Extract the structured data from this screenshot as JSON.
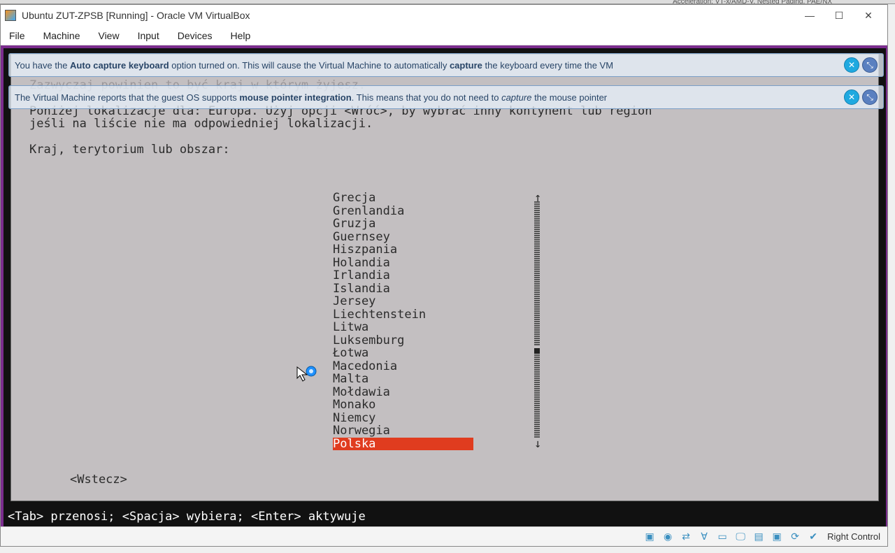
{
  "partial_top": "Acceleration:      VT-x/AMD-V, Nested Paging, PAE/NX",
  "titlebar": {
    "title": "Ubuntu ZUT-ZPSB [Running] - Oracle VM VirtualBox"
  },
  "menubar": [
    "File",
    "Machine",
    "View",
    "Input",
    "Devices",
    "Help"
  ],
  "notif1": {
    "pre": "You have the ",
    "bold": "Auto capture keyboard",
    "mid": " option turned on. This will cause the Virtual Machine to automatically ",
    "bold2": "capture",
    "post": " the keyboard every time the VM"
  },
  "notif2": {
    "pre": "The Virtual Machine reports that the guest OS supports ",
    "bold": "mouse pointer integration",
    "mid": ". This means that you do not need to ",
    "italic": "capture",
    "post": " the mouse pointer"
  },
  "installer": {
    "faded_line": "Zazwyczaj powinien to być kraj w którym żyjesz.",
    "line1": "Poniżej lokalizacje dla: Europa. Użyj opcji <Wróć>, by wybrać inny kontynent lub region",
    "line2": "jeśli na liście nie ma odpowiedniej lokalizacji.",
    "line3": "Kraj, terytorium lub obszar:",
    "back": "<Wstecz>"
  },
  "countries": [
    "Grecja",
    "Grenlandia",
    "Gruzja",
    "Guernsey",
    "Hiszpania",
    "Holandia",
    "Irlandia",
    "Islandia",
    "Jersey",
    "Liechtenstein",
    "Litwa",
    "Luksemburg",
    "Łotwa",
    "Macedonia",
    "Malta",
    "Mołdawia",
    "Monako",
    "Niemcy",
    "Norwegia",
    "Polska"
  ],
  "selected_index": 19,
  "helpbar": "<Tab> przenosi; <Spacja> wybiera; <Enter> aktywuje",
  "statusbar": {
    "host_key": "Right Control"
  },
  "status_icons": [
    "hard-disk-icon",
    "optical-disk-icon",
    "network-icon",
    "usb-icon",
    "shared-folder-icon",
    "display-icon",
    "clipboard-icon",
    "recording-icon",
    "vm-state-icon",
    "mouse-integration-icon"
  ]
}
